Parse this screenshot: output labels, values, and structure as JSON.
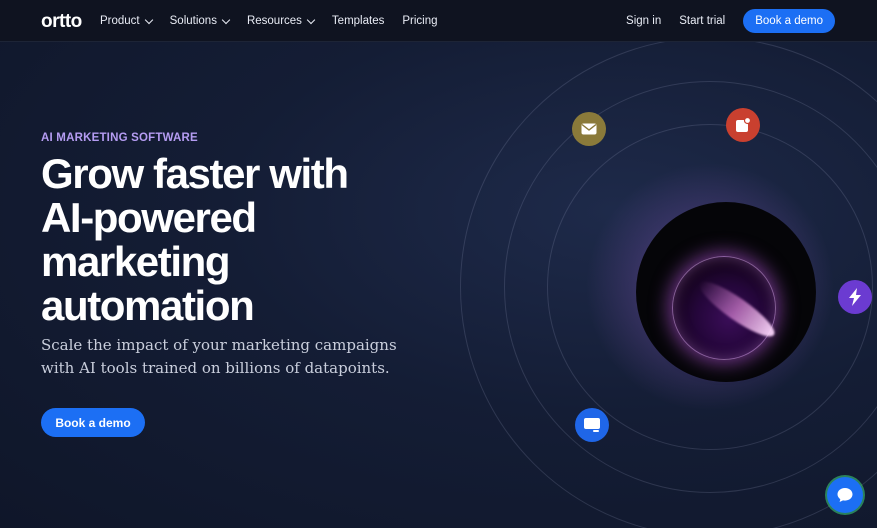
{
  "header": {
    "logo": "ortto",
    "nav": [
      {
        "label": "Product",
        "dropdown": true
      },
      {
        "label": "Solutions",
        "dropdown": true
      },
      {
        "label": "Resources",
        "dropdown": true
      },
      {
        "label": "Templates",
        "dropdown": false
      },
      {
        "label": "Pricing",
        "dropdown": false
      }
    ],
    "sign_in": "Sign in",
    "start_trial": "Start trial",
    "book_demo": "Book a demo"
  },
  "hero": {
    "eyebrow": "AI MARKETING SOFTWARE",
    "headline_lines": [
      "Grow faster with",
      "AI-powered",
      "marketing",
      "automation"
    ],
    "subhead_lines": [
      "Scale the impact of your marketing campaigns",
      "with AI tools trained on billions of datapoints."
    ],
    "cta": "Book a demo"
  },
  "visual": {
    "nodes": [
      {
        "name": "email",
        "icon": "mail-icon",
        "color": "#8a7a3a"
      },
      {
        "name": "notification",
        "icon": "notification-icon",
        "color": "#c9402f"
      },
      {
        "name": "automation",
        "icon": "lightning-icon",
        "color": "#6b3bd1"
      },
      {
        "name": "message",
        "icon": "chat-window-icon",
        "color": "#1f66e8"
      }
    ]
  },
  "chat_widget": {
    "icon": "chat-bubble-icon",
    "color": "#1c6ff4"
  }
}
